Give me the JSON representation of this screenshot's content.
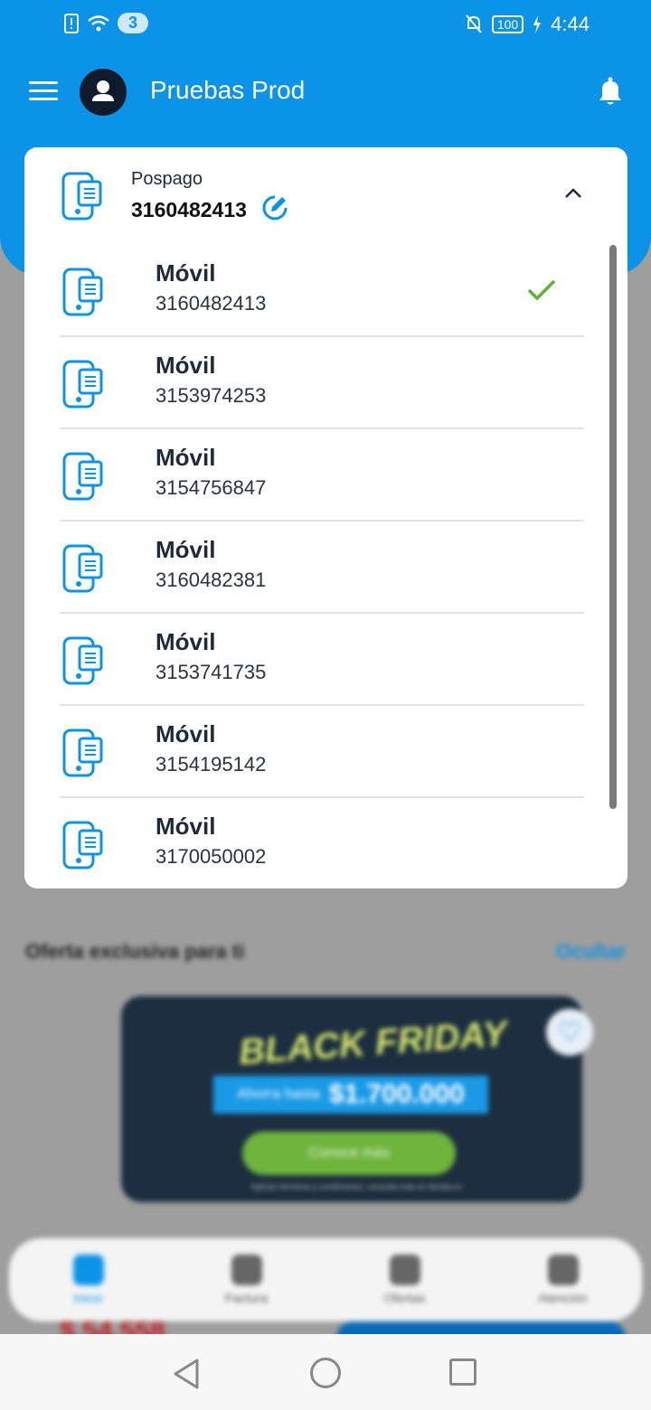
{
  "status_bar": {
    "notif_count": "3",
    "battery": "100",
    "time": "4:44"
  },
  "app": {
    "title": "Pruebas Prod"
  },
  "selector": {
    "type_label": "Pospago",
    "selected_number": "3160482413"
  },
  "lines": [
    {
      "type": "Móvil",
      "number": "3160482413",
      "selected": true
    },
    {
      "type": "Móvil",
      "number": "3153974253"
    },
    {
      "type": "Móvil",
      "number": "3154756847"
    },
    {
      "type": "Móvil",
      "number": "3160482381"
    },
    {
      "type": "Móvil",
      "number": "3153741735"
    },
    {
      "type": "Móvil",
      "number": "3154195142"
    },
    {
      "type": "Móvil",
      "number": "3170050002"
    }
  ],
  "offers": {
    "title": "Oferta exclusiva para ti",
    "hide_label": "Ocultar",
    "banner": {
      "headline": "BLACK FRIDAY",
      "save_prefix": "Ahorra hasta",
      "amount": "$1.700.000",
      "cta": "Conoce más",
      "legal": "Aplican términos y condiciones, consulta más en tienda.co"
    }
  },
  "background_price": "$ 54.558",
  "bottom_nav": [
    {
      "label": "Inicio",
      "icon": "home-icon",
      "active": true
    },
    {
      "label": "Factura",
      "icon": "invoice-icon"
    },
    {
      "label": "Ofertas",
      "icon": "offers-icon"
    },
    {
      "label": "Atención",
      "icon": "support-icon"
    }
  ],
  "colors": {
    "primary": "#0b93e8",
    "check": "#5fb136",
    "navy": "#0d1b2a"
  }
}
